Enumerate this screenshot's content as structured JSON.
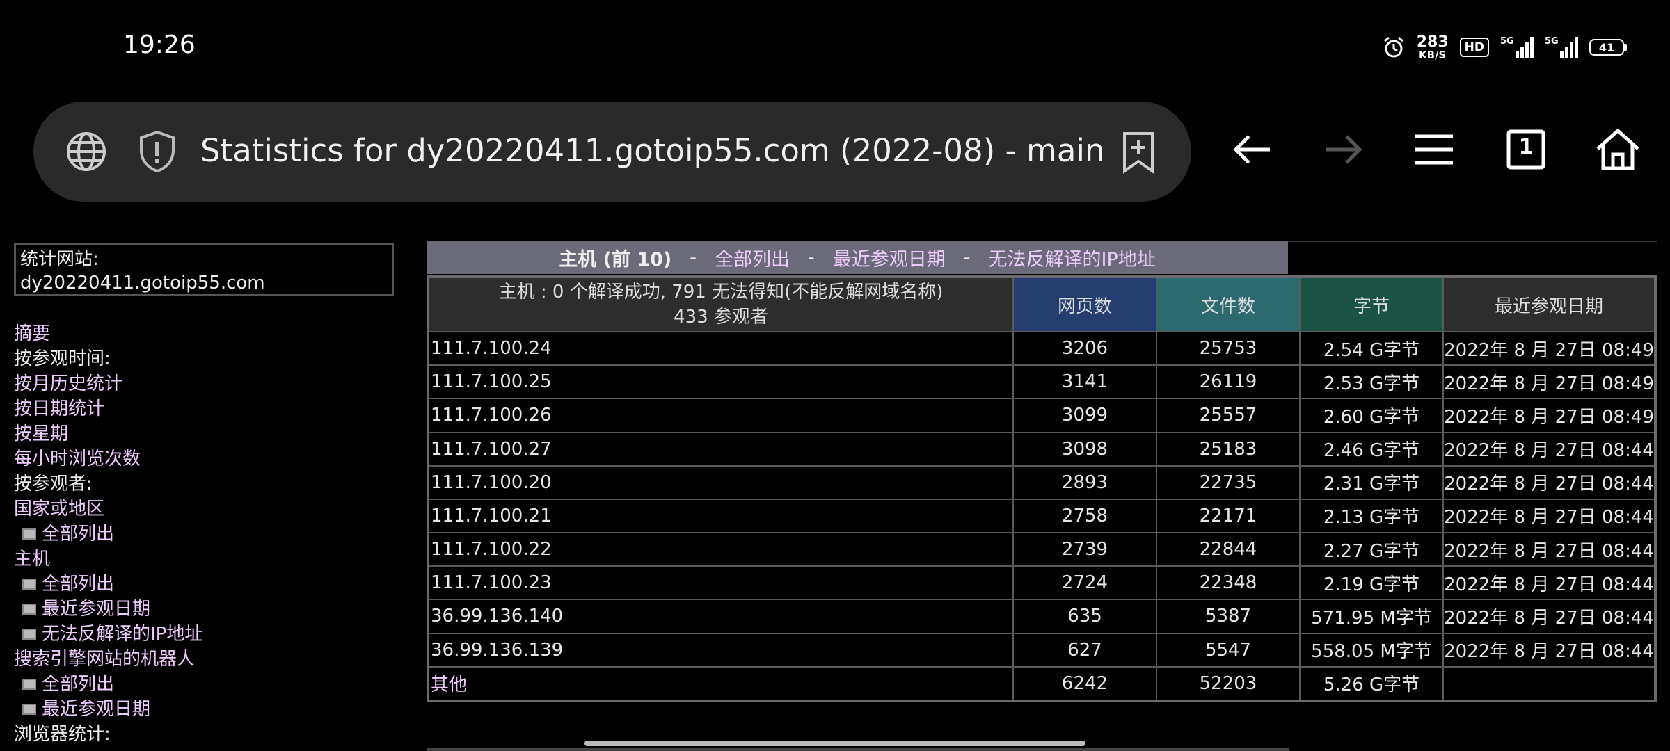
{
  "status_bar": {
    "time": "19:26",
    "net_speed_value": "283",
    "net_speed_unit": "KB/S",
    "hd_label": "HD",
    "signal1_label": "5G",
    "signal2_label": "5G",
    "battery": "41",
    "icons": [
      "alarm-icon",
      "hd-icon",
      "signal-icon",
      "signal-icon",
      "battery-icon"
    ]
  },
  "browser": {
    "url_title": "Statistics for dy20220411.gotoip55.com (2022-08) - main",
    "tab_count": "1",
    "icons": [
      "globe-icon",
      "shield-icon",
      "bookmark-add-icon",
      "back-arrow-icon",
      "forward-arrow-icon",
      "menu-icon",
      "tabs-icon",
      "home-icon"
    ]
  },
  "sidebar": {
    "site_label": "统计网站:",
    "site_value": "dy20220411.gotoip55.com",
    "items": [
      {
        "label": "摘要",
        "type": "link"
      },
      {
        "label": "按参观时间:",
        "type": "head"
      },
      {
        "label": "按月历史统计",
        "type": "link"
      },
      {
        "label": "按日期统计",
        "type": "link"
      },
      {
        "label": "按星期",
        "type": "link"
      },
      {
        "label": "每小时浏览次数",
        "type": "link"
      },
      {
        "label": "按参观者:",
        "type": "head"
      },
      {
        "label": "国家或地区",
        "type": "link"
      },
      {
        "label": "全部列出",
        "type": "sub"
      },
      {
        "label": "主机",
        "type": "link"
      },
      {
        "label": "全部列出",
        "type": "sub"
      },
      {
        "label": "最近参观日期",
        "type": "sub"
      },
      {
        "label": "无法反解译的IP地址",
        "type": "sub"
      },
      {
        "label": "搜索引擎网站的机器人",
        "type": "link"
      },
      {
        "label": "全部列出",
        "type": "sub"
      },
      {
        "label": "最近参观日期",
        "type": "sub"
      },
      {
        "label": "浏览器统计:",
        "type": "head"
      }
    ]
  },
  "section": {
    "title": "主机 (前 10)",
    "sep": "-",
    "links": [
      "全部列出",
      "最近参观日期",
      "无法反解译的IP地址"
    ]
  },
  "table": {
    "header_host_line1": "主机 : 0 个解译成功, 791 无法得知(不能反解网域名称)",
    "header_host_line2": "433 参观者",
    "col_pages": "网页数",
    "col_files": "文件数",
    "col_bytes": "字节",
    "col_date": "最近参观日期",
    "rows": [
      {
        "host": "111.7.100.24",
        "pages": "3206",
        "files": "25753",
        "bytes": "2.54 G字节",
        "date": "2022年 8 月 27日 08:49"
      },
      {
        "host": "111.7.100.25",
        "pages": "3141",
        "files": "26119",
        "bytes": "2.53 G字节",
        "date": "2022年 8 月 27日 08:49"
      },
      {
        "host": "111.7.100.26",
        "pages": "3099",
        "files": "25557",
        "bytes": "2.60 G字节",
        "date": "2022年 8 月 27日 08:49"
      },
      {
        "host": "111.7.100.27",
        "pages": "3098",
        "files": "25183",
        "bytes": "2.46 G字节",
        "date": "2022年 8 月 27日 08:44"
      },
      {
        "host": "111.7.100.20",
        "pages": "2893",
        "files": "22735",
        "bytes": "2.31 G字节",
        "date": "2022年 8 月 27日 08:44"
      },
      {
        "host": "111.7.100.21",
        "pages": "2758",
        "files": "22171",
        "bytes": "2.13 G字节",
        "date": "2022年 8 月 27日 08:44"
      },
      {
        "host": "111.7.100.22",
        "pages": "2739",
        "files": "22844",
        "bytes": "2.27 G字节",
        "date": "2022年 8 月 27日 08:44"
      },
      {
        "host": "111.7.100.23",
        "pages": "2724",
        "files": "22348",
        "bytes": "2.19 G字节",
        "date": "2022年 8 月 27日 08:44"
      },
      {
        "host": "36.99.136.140",
        "pages": "635",
        "files": "5387",
        "bytes": "571.95 M字节",
        "date": "2022年 8 月 27日 08:44"
      },
      {
        "host": "36.99.136.139",
        "pages": "627",
        "files": "5547",
        "bytes": "558.05 M字节",
        "date": "2022年 8 月 27日 08:44"
      }
    ],
    "other": {
      "host": "其他",
      "pages": "6242",
      "files": "52203",
      "bytes": "5.26 G字节",
      "date": ""
    }
  },
  "colors": {
    "link": "#eecbff",
    "pages_header": "#253d6f",
    "files_header": "#2c6a6f",
    "bytes_header": "#1b5445",
    "section_bar": "#6b6a78"
  }
}
